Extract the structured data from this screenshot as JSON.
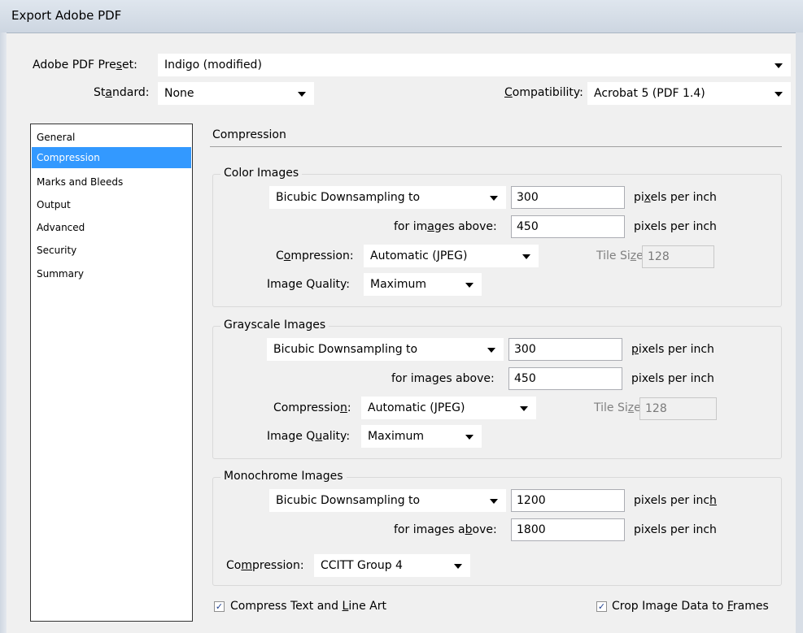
{
  "window": {
    "title": "Export Adobe PDF"
  },
  "header": {
    "preset_label": "Adobe PDF Preset:",
    "preset_value": "Indigo (modified)",
    "standard_label": "Standard:",
    "standard_value": "None",
    "compatibility_label": "Compatibility:",
    "compatibility_value": "Acrobat 5 (PDF 1.4)"
  },
  "nav": {
    "items": [
      "General",
      "Compression",
      "Marks and Bleeds",
      "Output",
      "Advanced",
      "Security",
      "Summary"
    ],
    "selected": "Compression"
  },
  "panel": {
    "title": "Compression"
  },
  "color_images": {
    "title": "Color Images",
    "downsample_method": "Bicubic Downsampling to",
    "downsample_ppi": "300",
    "ppi_unit": "pixels per inch",
    "above_label": "for images above:",
    "above_ppi": "450",
    "above_unit": "pixels per inch",
    "compression_label": "Compression:",
    "compression_value": "Automatic (JPEG)",
    "tile_size_label": "Tile Size:",
    "tile_size_value": "128",
    "quality_label": "Image Quality:",
    "quality_value": "Maximum"
  },
  "grayscale_images": {
    "title": "Grayscale Images",
    "downsample_method": "Bicubic Downsampling to",
    "downsample_ppi": "300",
    "ppi_unit": "pixels per inch",
    "above_label": "for images above:",
    "above_ppi": "450",
    "above_unit": "pixels per inch",
    "compression_label": "Compression:",
    "compression_value": "Automatic (JPEG)",
    "tile_size_label": "Tile Size:",
    "tile_size_value": "128",
    "quality_label": "Image Quality:",
    "quality_value": "Maximum"
  },
  "monochrome_images": {
    "title": "Monochrome Images",
    "downsample_method": "Bicubic Downsampling to",
    "downsample_ppi": "1200",
    "ppi_unit": "pixels per inch",
    "above_label": "for images above:",
    "above_ppi": "1800",
    "above_unit": "pixels per inch",
    "compression_label": "Compression:",
    "compression_value": "CCITT Group 4"
  },
  "options": {
    "compress_text": {
      "label": "Compress Text and Line Art",
      "checked": true
    },
    "crop_image": {
      "label": "Crop Image Data to Frames",
      "checked": true
    }
  },
  "colors": {
    "selection": "#3399ff",
    "background": "#f0f0f0"
  }
}
